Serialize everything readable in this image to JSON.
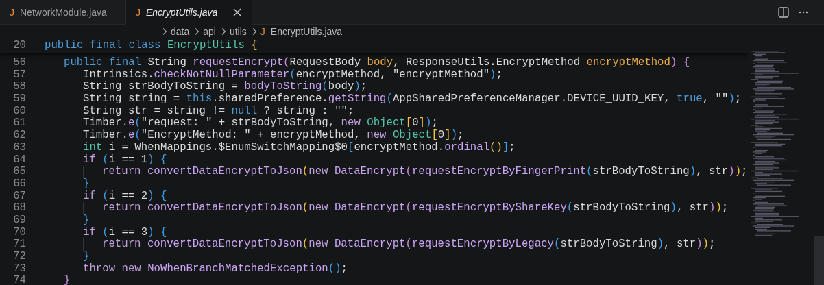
{
  "tabs": [
    {
      "icon": "J",
      "label": "NetworkModule.java",
      "selected": false,
      "preview": false
    },
    {
      "icon": "J",
      "label": "EncryptUtils.java",
      "selected": true,
      "preview": true
    }
  ],
  "breadcrumbs": [
    {
      "label": "data"
    },
    {
      "label": "api"
    },
    {
      "label": "utils"
    },
    {
      "icon": "J",
      "label": "EncryptUtils.java"
    }
  ],
  "sticky_line": {
    "number": "20",
    "tokens": [
      {
        "text": "public final class ",
        "kind": "kw"
      },
      {
        "text": "EncryptUtils ",
        "kind": "cls"
      },
      {
        "text": "{",
        "kind": "b1"
      }
    ]
  },
  "lines": [
    {
      "number": "56",
      "tokens": [
        {
          "text": "\tpublic final",
          "kind": "kw"
        },
        {
          "text": " String ",
          "kind": "p"
        },
        {
          "text": "requestEncrypt",
          "kind": "fn"
        },
        {
          "text": "(",
          "kind": "b2"
        },
        {
          "text": "RequestBody ",
          "kind": "p"
        },
        {
          "text": "body",
          "kind": "prm"
        },
        {
          "text": ", ResponseUtils.EncryptMethod ",
          "kind": "p"
        },
        {
          "text": "encryptMethod",
          "kind": "prm"
        },
        {
          "text": ") {",
          "kind": "b2"
        }
      ]
    },
    {
      "number": "57",
      "tokens": [
        {
          "text": "\t\tIntrinsics.",
          "kind": "p"
        },
        {
          "text": "checkNotNullParameter",
          "kind": "fn"
        },
        {
          "text": "(",
          "kind": "b3"
        },
        {
          "text": "encryptMethod, \"encryptMethod\"",
          "kind": "p"
        },
        {
          "text": ")",
          "kind": "b3"
        },
        {
          "text": ";",
          "kind": "p"
        }
      ]
    },
    {
      "number": "58",
      "tokens": [
        {
          "text": "\t\tString strBodyToString = ",
          "kind": "p"
        },
        {
          "text": "bodyToString",
          "kind": "fn"
        },
        {
          "text": "(",
          "kind": "b3"
        },
        {
          "text": "body",
          "kind": "p"
        },
        {
          "text": ")",
          "kind": "b3"
        },
        {
          "text": ";",
          "kind": "p"
        }
      ]
    },
    {
      "number": "59",
      "tokens": [
        {
          "text": "\t\tString string = ",
          "kind": "p"
        },
        {
          "text": "this",
          "kind": "kw"
        },
        {
          "text": ".sharedPreference.",
          "kind": "p"
        },
        {
          "text": "getString",
          "kind": "fn"
        },
        {
          "text": "(",
          "kind": "b3"
        },
        {
          "text": "AppSharedPreferenceManager.DEVICE_UUID_KEY, ",
          "kind": "p"
        },
        {
          "text": "true",
          "kind": "kw"
        },
        {
          "text": ", \"\"",
          "kind": "p"
        },
        {
          "text": ")",
          "kind": "b3"
        },
        {
          "text": ";",
          "kind": "p"
        }
      ]
    },
    {
      "number": "60",
      "tokens": [
        {
          "text": "\t\tString str = string != ",
          "kind": "p"
        },
        {
          "text": "null",
          "kind": "kw"
        },
        {
          "text": " ? string : \"\";",
          "kind": "p"
        }
      ]
    },
    {
      "number": "61",
      "tokens": [
        {
          "text": "\t\tTimber.",
          "kind": "p"
        },
        {
          "text": "e",
          "kind": "fn"
        },
        {
          "text": "(",
          "kind": "b3"
        },
        {
          "text": "\"request: \" + strBodyToString, ",
          "kind": "p"
        },
        {
          "text": "new ",
          "kind": "ctl"
        },
        {
          "text": "Object",
          "kind": "cls"
        },
        {
          "text": "[",
          "kind": "b1"
        },
        {
          "text": "0",
          "kind": "p"
        },
        {
          "text": "]",
          "kind": "b1"
        },
        {
          "text": ")",
          "kind": "b3"
        },
        {
          "text": ";",
          "kind": "p"
        }
      ]
    },
    {
      "number": "62",
      "tokens": [
        {
          "text": "\t\tTimber.",
          "kind": "p"
        },
        {
          "text": "e",
          "kind": "fn"
        },
        {
          "text": "(",
          "kind": "b3"
        },
        {
          "text": "\"EncryptMethod: \" + encryptMethod, ",
          "kind": "p"
        },
        {
          "text": "new ",
          "kind": "ctl"
        },
        {
          "text": "Object",
          "kind": "cls"
        },
        {
          "text": "[",
          "kind": "b1"
        },
        {
          "text": "0",
          "kind": "p"
        },
        {
          "text": "]",
          "kind": "b1"
        },
        {
          "text": ")",
          "kind": "b3"
        },
        {
          "text": ";",
          "kind": "p"
        }
      ]
    },
    {
      "number": "63",
      "tokens": [
        {
          "text": "\t\tint",
          "kind": "cls"
        },
        {
          "text": " i = WhenMappings.$EnumSwitchMapping$0",
          "kind": "p"
        },
        {
          "text": "[",
          "kind": "b3"
        },
        {
          "text": "encryptMethod.",
          "kind": "p"
        },
        {
          "text": "ordinal",
          "kind": "fn"
        },
        {
          "text": "()",
          "kind": "b1"
        },
        {
          "text": "]",
          "kind": "b3"
        },
        {
          "text": ";",
          "kind": "p"
        }
      ]
    },
    {
      "number": "64",
      "tokens": [
        {
          "text": "\t\tif ",
          "kind": "ctl"
        },
        {
          "text": "(",
          "kind": "b3"
        },
        {
          "text": "i == 1",
          "kind": "p"
        },
        {
          "text": ") {",
          "kind": "b3"
        }
      ]
    },
    {
      "number": "65",
      "tokens": [
        {
          "text": "\t\t\treturn ",
          "kind": "ctl"
        },
        {
          "text": "convertDataEncryptToJson",
          "kind": "fn"
        },
        {
          "text": "(",
          "kind": "b1"
        },
        {
          "text": "new ",
          "kind": "ctl"
        },
        {
          "text": "DataEncrypt",
          "kind": "fn"
        },
        {
          "text": "(",
          "kind": "b2"
        },
        {
          "text": "requestEncryptByFingerPrint",
          "kind": "fn"
        },
        {
          "text": "(",
          "kind": "b3"
        },
        {
          "text": "strBodyToString",
          "kind": "p"
        },
        {
          "text": ")",
          "kind": "b3"
        },
        {
          "text": ", str",
          "kind": "p"
        },
        {
          "text": ")",
          "kind": "b2"
        },
        {
          "text": ")",
          "kind": "b1"
        },
        {
          "text": ";",
          "kind": "p"
        }
      ]
    },
    {
      "number": "66",
      "tokens": [
        {
          "text": "\t\t}",
          "kind": "b3"
        }
      ]
    },
    {
      "number": "67",
      "tokens": [
        {
          "text": "\t\tif ",
          "kind": "ctl"
        },
        {
          "text": "(",
          "kind": "b3"
        },
        {
          "text": "i == 2",
          "kind": "p"
        },
        {
          "text": ") {",
          "kind": "b3"
        }
      ]
    },
    {
      "number": "68",
      "tokens": [
        {
          "text": "\t\t\treturn ",
          "kind": "ctl"
        },
        {
          "text": "convertDataEncryptToJson",
          "kind": "fn"
        },
        {
          "text": "(",
          "kind": "b1"
        },
        {
          "text": "new ",
          "kind": "ctl"
        },
        {
          "text": "DataEncrypt",
          "kind": "fn"
        },
        {
          "text": "(",
          "kind": "b2"
        },
        {
          "text": "requestEncryptByShareKey",
          "kind": "fn"
        },
        {
          "text": "(",
          "kind": "b3"
        },
        {
          "text": "strBodyToString",
          "kind": "p"
        },
        {
          "text": ")",
          "kind": "b3"
        },
        {
          "text": ", str",
          "kind": "p"
        },
        {
          "text": ")",
          "kind": "b2"
        },
        {
          "text": ")",
          "kind": "b1"
        },
        {
          "text": ";",
          "kind": "p"
        }
      ]
    },
    {
      "number": "69",
      "tokens": [
        {
          "text": "\t\t}",
          "kind": "b3"
        }
      ]
    },
    {
      "number": "70",
      "tokens": [
        {
          "text": "\t\tif ",
          "kind": "ctl"
        },
        {
          "text": "(",
          "kind": "b3"
        },
        {
          "text": "i == 3",
          "kind": "p"
        },
        {
          "text": ") {",
          "kind": "b3"
        }
      ]
    },
    {
      "number": "71",
      "tokens": [
        {
          "text": "\t\t\treturn ",
          "kind": "ctl"
        },
        {
          "text": "convertDataEncryptToJson",
          "kind": "fn"
        },
        {
          "text": "(",
          "kind": "b1"
        },
        {
          "text": "new ",
          "kind": "ctl"
        },
        {
          "text": "DataEncrypt",
          "kind": "fn"
        },
        {
          "text": "(",
          "kind": "b2"
        },
        {
          "text": "requestEncryptByLegacy",
          "kind": "fn"
        },
        {
          "text": "(",
          "kind": "b3"
        },
        {
          "text": "strBodyToString",
          "kind": "p"
        },
        {
          "text": ")",
          "kind": "b3"
        },
        {
          "text": ", str",
          "kind": "p"
        },
        {
          "text": ")",
          "kind": "b2"
        },
        {
          "text": ")",
          "kind": "b1"
        },
        {
          "text": ";",
          "kind": "p"
        }
      ]
    },
    {
      "number": "72",
      "tokens": [
        {
          "text": "\t\t}",
          "kind": "b3"
        }
      ]
    },
    {
      "number": "73",
      "tokens": [
        {
          "text": "\t\tthrow new ",
          "kind": "ctl"
        },
        {
          "text": "NoWhenBranchMatchedException",
          "kind": "fn"
        },
        {
          "text": "()",
          "kind": "b3"
        },
        {
          "text": ";",
          "kind": "p"
        }
      ]
    },
    {
      "number": "74",
      "tokens": [
        {
          "text": "\t}",
          "kind": "b2"
        }
      ]
    }
  ]
}
